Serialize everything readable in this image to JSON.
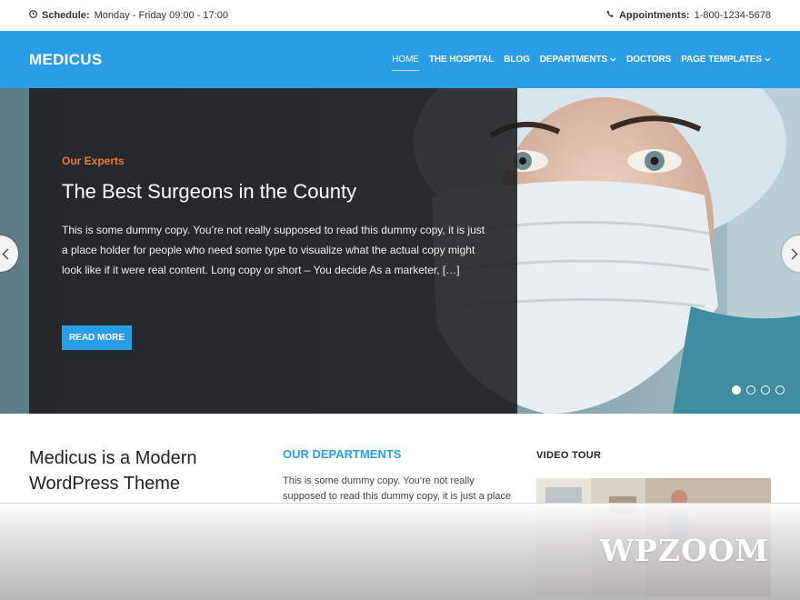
{
  "topbar": {
    "schedule_label": "Schedule:",
    "schedule_value": "Monday - Friday 09:00 - 17:00",
    "appointments_label": "Appointments:",
    "appointments_value": "1-800-1234-5678"
  },
  "header": {
    "logo": "MEDICUS",
    "nav": [
      {
        "label": "HOME",
        "active": true
      },
      {
        "label": "THE HOSPITAL"
      },
      {
        "label": "BLOG"
      },
      {
        "label": "DEPARTMENTS",
        "dropdown": true
      },
      {
        "label": "DOCTORS"
      },
      {
        "label": "PAGE TEMPLATES",
        "dropdown": true
      }
    ]
  },
  "hero": {
    "eyebrow": "Our Experts",
    "title": "The Best Surgeons in the County",
    "text": "This is some dummy copy. You’re not really supposed to read this dummy copy, it is just a place holder for people who need some type to visualize what the actual copy might look like if it were real content. Long copy or short – You decide As a marketer, […]",
    "button": "READ MORE",
    "slides": 4,
    "active_slide": 1
  },
  "content": {
    "intro_title": "Medicus is a Modern WordPress Theme",
    "departments_title": "OUR DEPARTMENTS",
    "departments_text": "This is some dummy copy. You’re not really supposed to read this dummy copy, it is just a place",
    "video_title": "VIDEO TOUR"
  },
  "watermark": "WPZOOM",
  "colors": {
    "primary": "#2a9ee5",
    "accent": "#e8793f"
  }
}
